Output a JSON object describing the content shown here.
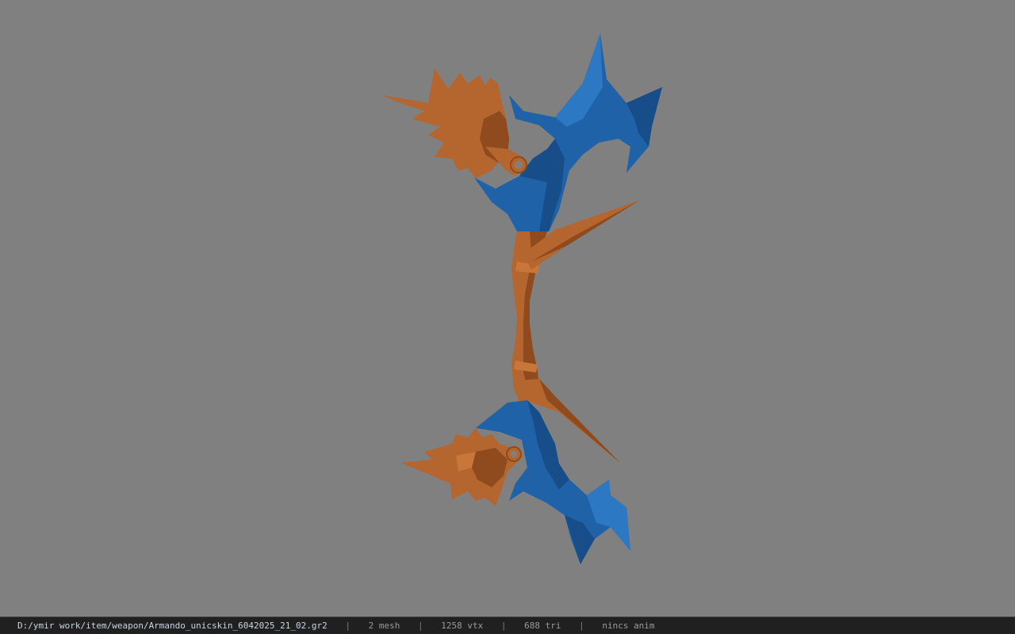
{
  "viewer": {
    "background_color": "#808080",
    "model": {
      "colors": {
        "blue": "#1f62a8",
        "blue_dark": "#174e8a",
        "blue_light": "#2d78c2",
        "orange": "#b5652e",
        "orange_dark": "#8f4a1d",
        "orange_light": "#c8763a"
      }
    }
  },
  "status_bar": {
    "file_path": "D:/ymir work/item/weapon/Armando_unicskin_6042025_21_02.gr2",
    "separator": "|",
    "mesh_count": "2 mesh",
    "vertex_count": "1258 vtx",
    "triangle_count": "688 tri",
    "animation": "nincs anim"
  }
}
